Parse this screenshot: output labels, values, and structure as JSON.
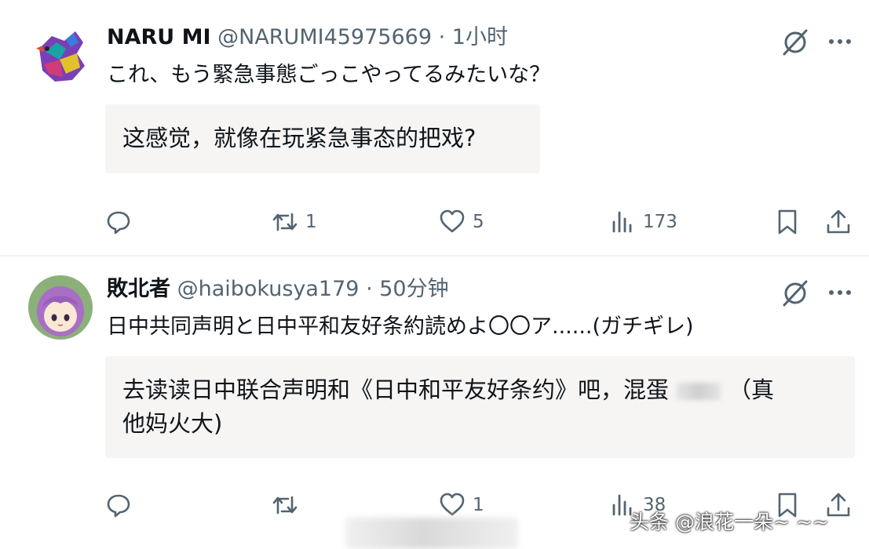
{
  "tweets": [
    {
      "display_name": "NARU MI",
      "handle": "@NARUMI45975669",
      "separator": "·",
      "time": "1小时",
      "text": "これ、もう緊急事態ごっこやってるみたいな？",
      "translation": "这感觉，就像在玩紧急事态的把戏?",
      "replies": "",
      "retweets": "1",
      "likes": "5",
      "views": "173"
    },
    {
      "display_name": "敗北者",
      "handle": "@haibokusya179",
      "separator": "·",
      "time": "50分钟",
      "text": "日中共同声明と日中平和友好条約読めよ〇〇ア......(ガチギレ)",
      "translation_part1": "去读读日中联合声明和《日中和平友好条约》吧，混蛋",
      "translation_part2": "（真",
      "translation_line2": "他妈火大)",
      "replies": "",
      "retweets": "",
      "likes": "1",
      "views": "38"
    }
  ],
  "watermark": "头条 @浪花一朵~ ~~",
  "colors": {
    "text": "#0f1419",
    "muted": "#536471",
    "translation_bg": "#f6f5f4"
  },
  "icons": [
    "grok-icon",
    "more-icon",
    "reply-icon",
    "retweet-icon",
    "like-icon",
    "views-icon",
    "bookmark-icon",
    "share-icon"
  ]
}
